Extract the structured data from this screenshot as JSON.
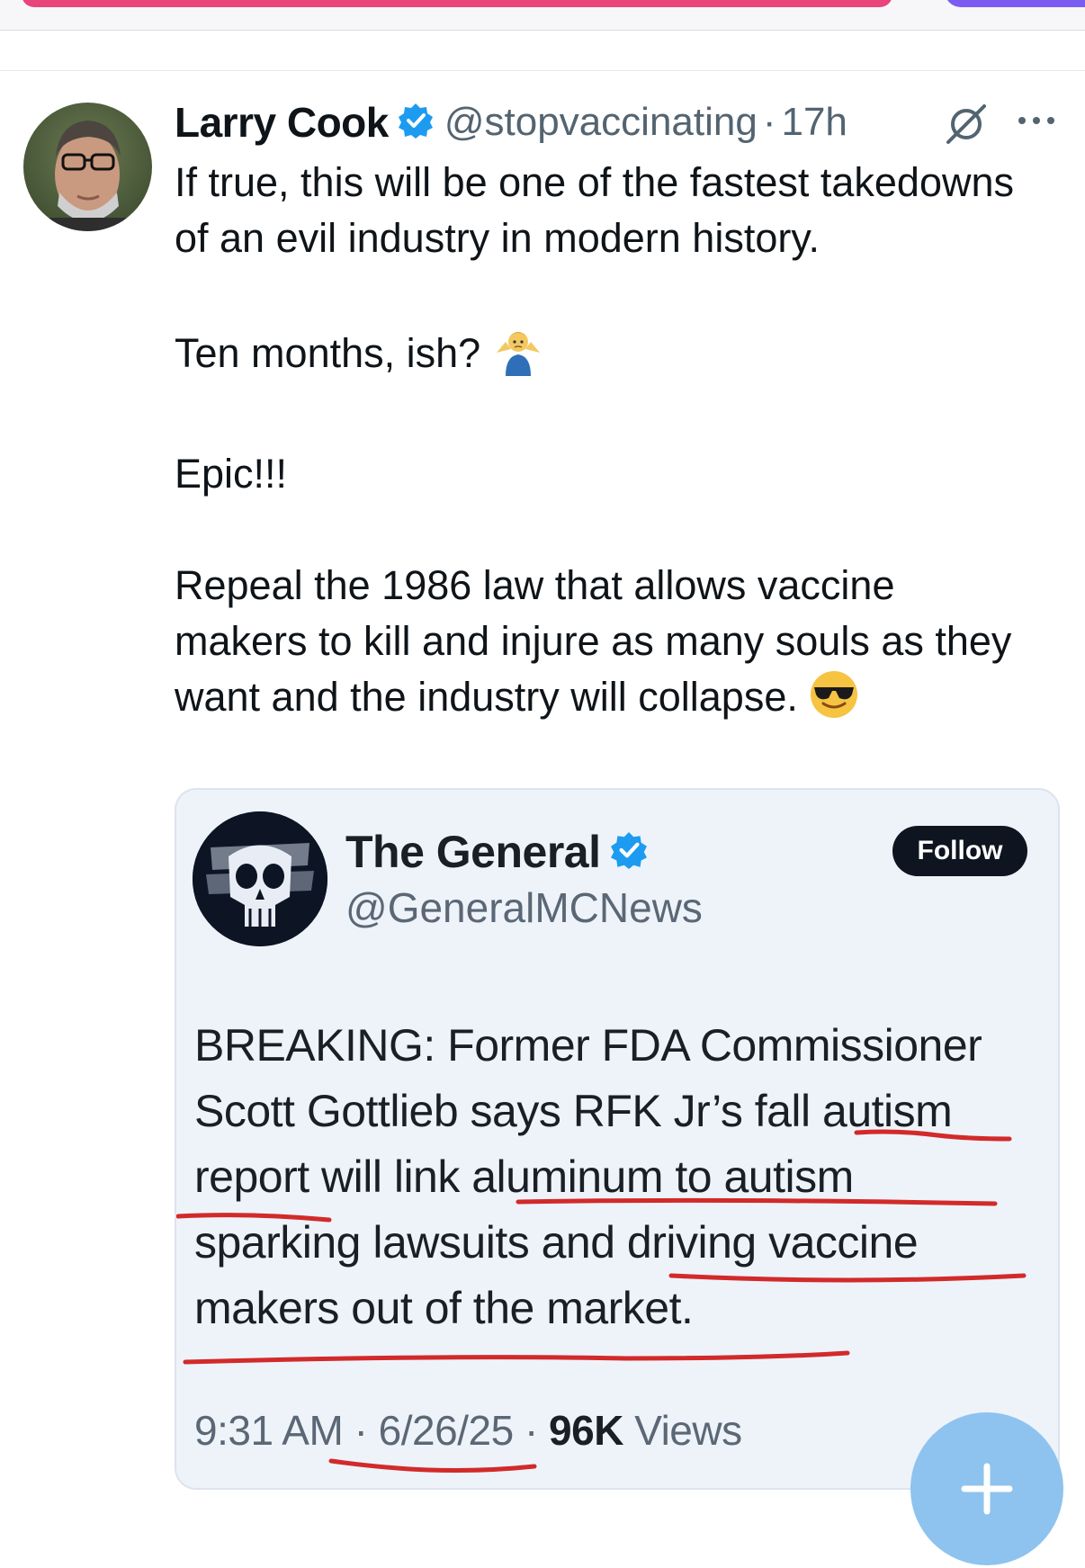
{
  "post": {
    "author_name": "Larry Cook",
    "handle": "@stopvaccinating",
    "separator": "·",
    "time": "17h",
    "paragraphs": [
      "If true, this will be one of the fastest takedowns of an evil industry in modern history.",
      "Ten months, ish?",
      "Epic!!!",
      "Repeal the 1986 law that allows vaccine makers to kill and injure as many souls as they want and the industry will collapse."
    ],
    "emoji": {
      "shrug": "person-shrugging-emoji",
      "sunglasses": "smiling-face-with-sunglasses-emoji"
    }
  },
  "quote": {
    "author_name": "The General",
    "handle": "@GeneralMCNews",
    "follow_label": "Follow",
    "text_lines": [
      "BREAKING: Former FDA Commissioner",
      "Scott Gottlieb says RFK Jr’s fall autism",
      "report will link aluminum to autism",
      "sparking lawsuits and driving vaccine",
      "makers out of the market."
    ],
    "time": "9:31 AM",
    "date": "6/26/25",
    "views_count": "96K",
    "views_label": "Views",
    "separator": "·"
  },
  "colors": {
    "verified_blue": "#1d9bf0",
    "handle_gray": "#536471",
    "quote_bg": "#eef3fa",
    "annotation_red": "#d22a2a",
    "fab_blue": "#8ec3ef",
    "top_pink": "#e8457a"
  },
  "icons": {
    "verified": "verified-badge-icon",
    "grok": "grok-icon",
    "more": "more-options-icon",
    "compose": "plus-icon"
  }
}
